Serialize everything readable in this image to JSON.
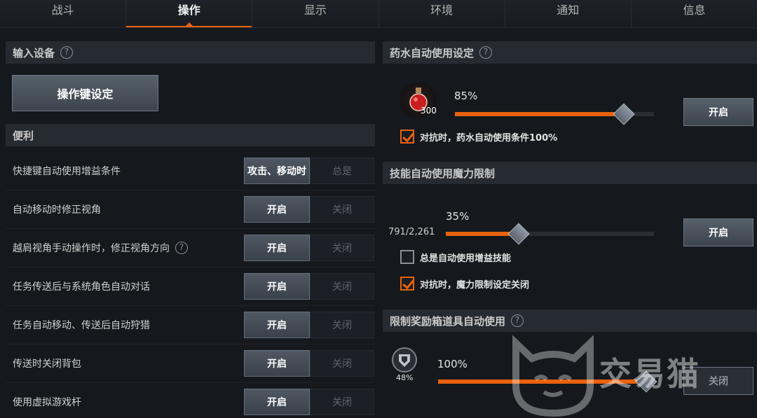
{
  "tabs": [
    "战斗",
    "操作",
    "显示",
    "环境",
    "通知",
    "信息"
  ],
  "left": {
    "input_section": {
      "title": "输入设备",
      "help": "?"
    },
    "key_setting_button": "操作键设定",
    "convenience_section": {
      "title": "便利"
    },
    "rows": [
      {
        "label": "快捷键自动使用增益条件",
        "on": "攻击、移动时",
        "off": "总是",
        "help": false
      },
      {
        "label": "自动移动时修正视角",
        "on": "开启",
        "off": "关闭",
        "help": false
      },
      {
        "label": "越肩视角手动操作时，修正视角方向",
        "on": "开启",
        "off": "关闭",
        "help": true
      },
      {
        "label": "任务传送后与系统角色自动对话",
        "on": "开启",
        "off": "关闭",
        "help": false
      },
      {
        "label": "任务自动移动、传送后自动狩猎",
        "on": "开启",
        "off": "关闭",
        "help": false
      },
      {
        "label": "传送时关闭背包",
        "on": "开启",
        "off": "关闭",
        "help": false
      },
      {
        "label": "使用虚拟游戏杆",
        "on": "开启",
        "off": "关闭",
        "help": false
      }
    ]
  },
  "right": {
    "potion_section": {
      "title": "药水自动使用设定",
      "help": "?"
    },
    "potion": {
      "count": "300",
      "percent": "85%",
      "percent_value": 85,
      "button": "开启",
      "check_label": "对抗时，药水自动使用条件100%",
      "checked": true
    },
    "mana_section": {
      "title": "技能自动使用魔力限制"
    },
    "mana": {
      "value_text": "791/2,261",
      "percent": "35%",
      "percent_value": 35,
      "button": "开启",
      "check1_label": "总是自动使用增益技能",
      "check1_checked": false,
      "check2_label": "对抗时，魔力限制设定关闭",
      "check2_checked": true
    },
    "reward_section": {
      "title": "限制奖励箱道具自动使用",
      "help": "?"
    },
    "reward": {
      "icon_percent": "48%",
      "percent": "100%",
      "percent_value": 100,
      "button": "关闭"
    }
  },
  "watermark": {
    "text": "交易猫"
  },
  "colors": {
    "accent": "#e8620f",
    "background": "#15181d",
    "section": "#262a31"
  }
}
